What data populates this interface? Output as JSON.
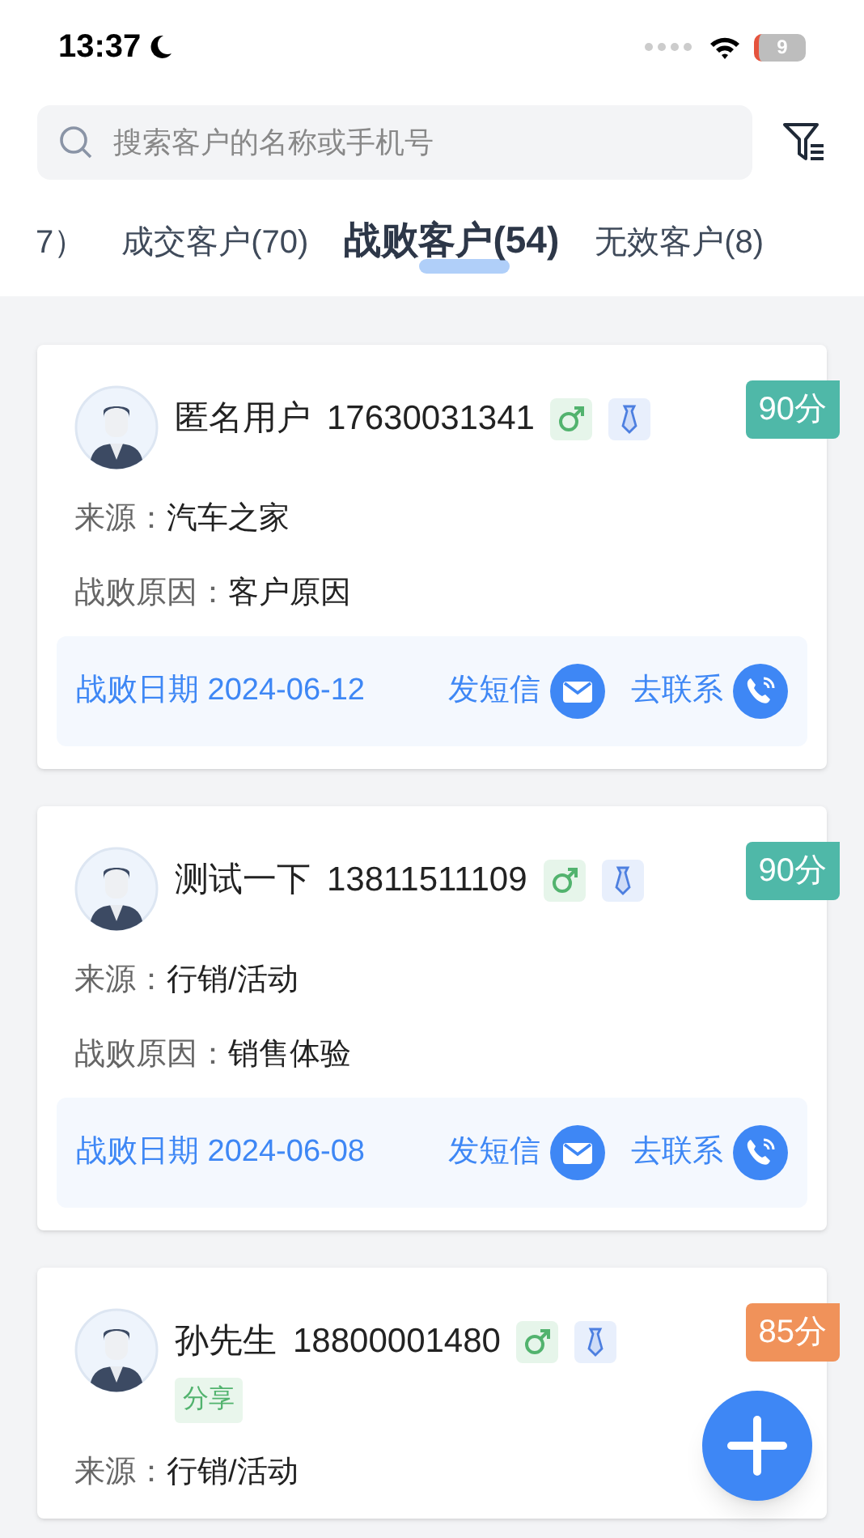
{
  "status_bar": {
    "time": "13:37",
    "battery": "9"
  },
  "search": {
    "placeholder": "搜索客户的名称或手机号"
  },
  "tabs": [
    {
      "label": "7）",
      "selected": false
    },
    {
      "label": "成交客户(70)",
      "selected": false
    },
    {
      "label": "战败客户(54)",
      "selected": true
    },
    {
      "label": "无效客户(8)",
      "selected": false
    }
  ],
  "customers": [
    {
      "name": "匿名用户",
      "phone": "17630031341",
      "score": "90分",
      "color": "#4fb8a8",
      "source_label": "来源：",
      "source": "汽车之家",
      "reason_label": "战败原因：",
      "reason": "客户原因",
      "date": "战败日期 2024-06-12",
      "sms": "发短信",
      "call": "去联系"
    },
    {
      "name": "测试一下",
      "phone": "13811511109",
      "score": "90分",
      "color": "#4fb8a8",
      "source_label": "来源：",
      "source": "行销/活动",
      "reason_label": "战败原因：",
      "reason": "销售体验",
      "date": "战败日期 2024-06-08",
      "sms": "发短信",
      "call": "去联系"
    },
    {
      "name": "孙先生",
      "phone": "18800001480",
      "score": "85分",
      "color": "#f0925a",
      "tags": [
        "分享"
      ],
      "source_label": "来源：",
      "source": "行销/活动"
    }
  ]
}
